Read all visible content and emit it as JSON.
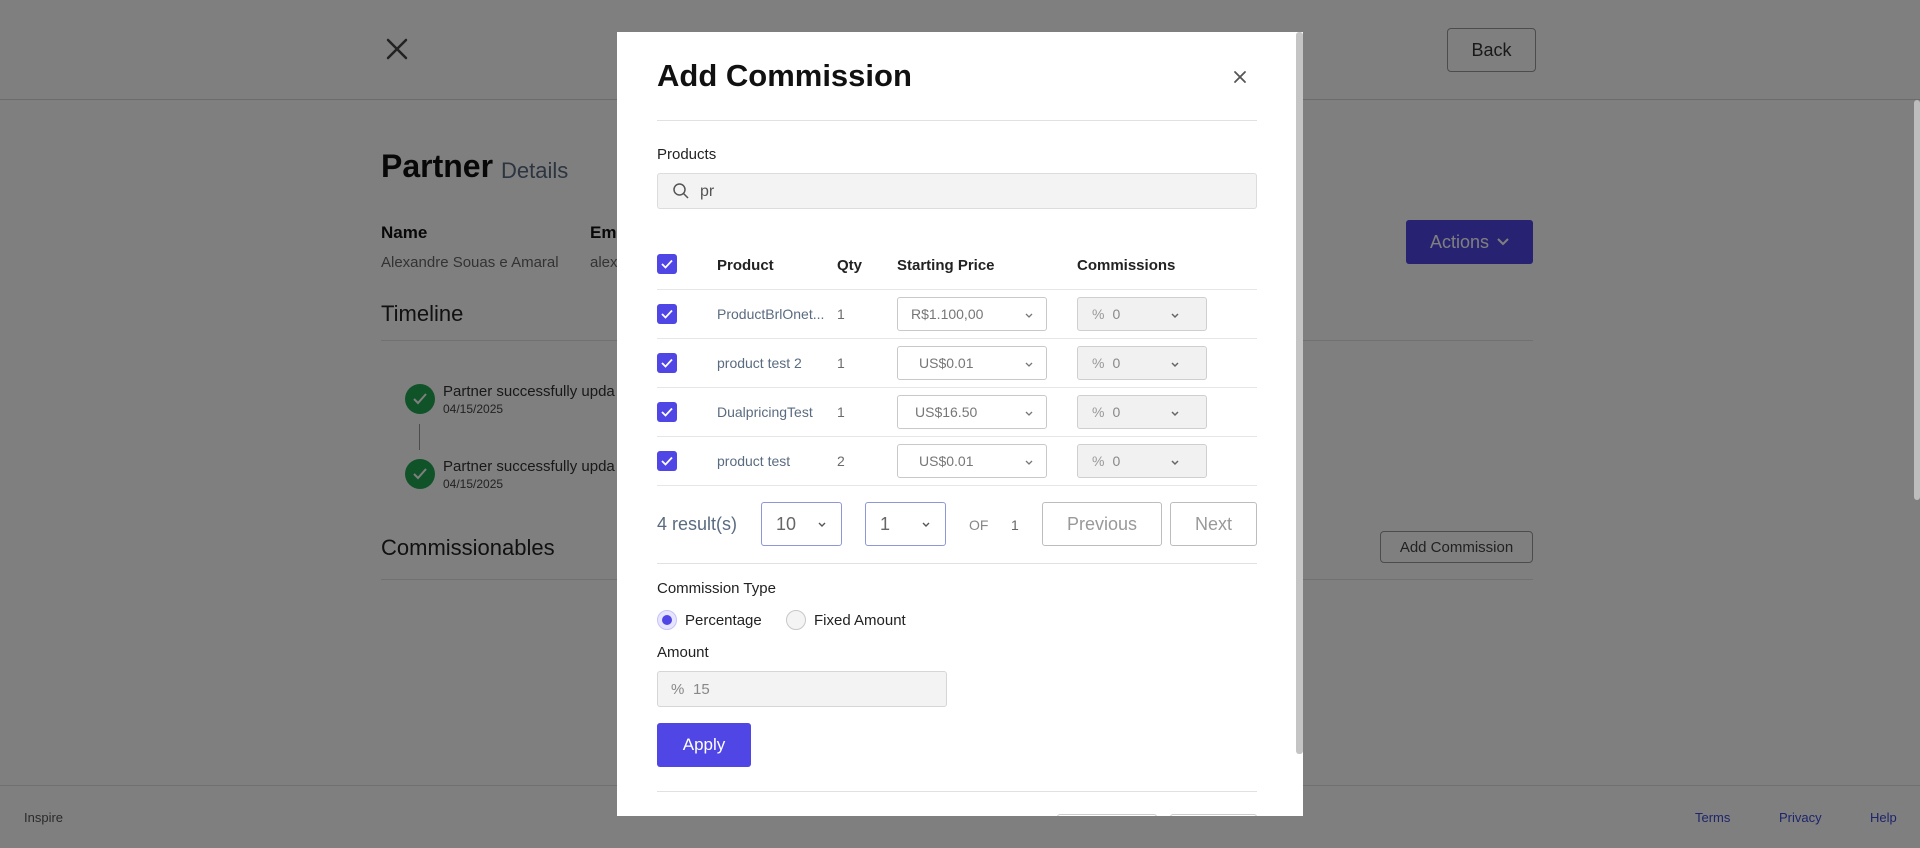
{
  "page": {
    "back_label": "Back",
    "title": "Partner",
    "subtitle": "Details",
    "name_label": "Name",
    "name_value": "Alexandre Souas e Amaral",
    "email_label": "Ema",
    "email_value": "alex",
    "actions_label": "Actions",
    "timeline_title": "Timeline",
    "timeline": [
      {
        "text": "Partner successfully upda",
        "date": "04/15/2025"
      },
      {
        "text": "Partner successfully upda",
        "date": "04/15/2025"
      }
    ],
    "commissionables_title": "Commissionables",
    "add_commission_label": "Add Commission"
  },
  "footer": {
    "brand": "Inspire",
    "links": [
      "Terms",
      "Privacy",
      "Help"
    ]
  },
  "modal": {
    "title": "Add Commission",
    "products_label": "Products",
    "search_value": "pr",
    "headers": [
      "Product",
      "Qty",
      "Starting Price",
      "Commissions"
    ],
    "rows": [
      {
        "product": "ProductBrlOnet...",
        "qty": "1",
        "price": "R$1.100,00",
        "comm_unit": "%",
        "comm_value": "0",
        "checked": true
      },
      {
        "product": "product test 2",
        "qty": "1",
        "price": "US$0.01",
        "comm_unit": "%",
        "comm_value": "0",
        "checked": true
      },
      {
        "product": "DualpricingTest",
        "qty": "1",
        "price": "US$16.50",
        "comm_unit": "%",
        "comm_value": "0",
        "checked": true
      },
      {
        "product": "product test",
        "qty": "2",
        "price": "US$0.01",
        "comm_unit": "%",
        "comm_value": "0",
        "checked": true
      }
    ],
    "pagination": {
      "results": "4 result(s)",
      "per_page": "10",
      "page": "1",
      "of_label": "OF",
      "total_pages": "1",
      "prev_label": "Previous",
      "next_label": "Next"
    },
    "commission_type_label": "Commission Type",
    "commission_types": [
      "Percentage",
      "Fixed Amount"
    ],
    "selected_type": "Percentage",
    "amount_label": "Amount",
    "amount_unit": "%",
    "amount_value": "15",
    "apply_label": "Apply"
  },
  "colors": {
    "accent": "#4f46e5",
    "success": "#22a652"
  }
}
